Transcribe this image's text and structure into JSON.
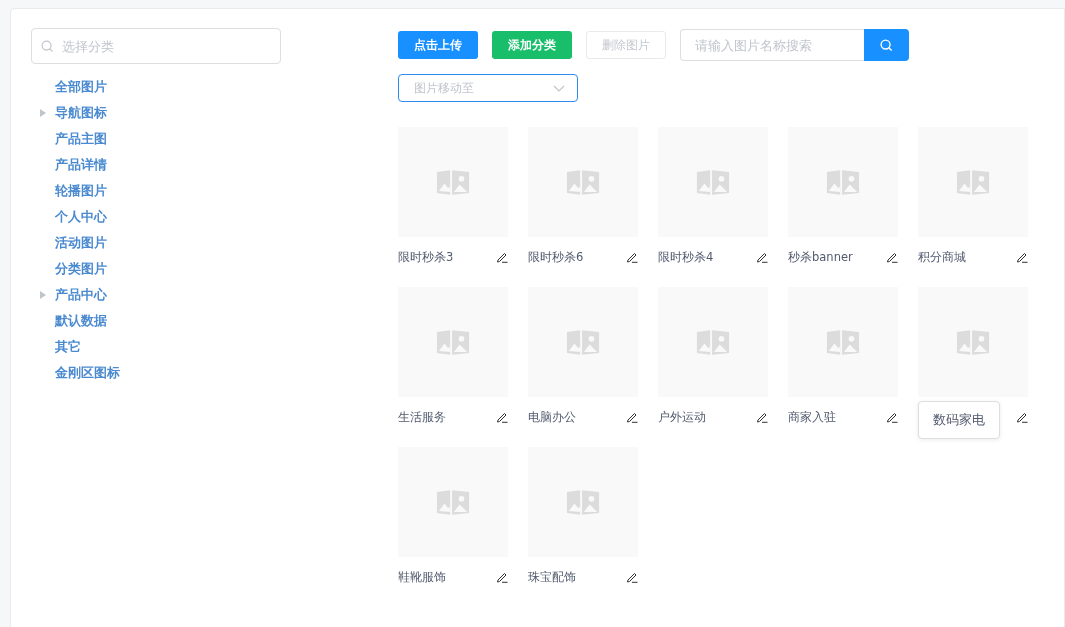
{
  "sidebar": {
    "search": {
      "placeholder": "选择分类"
    },
    "tree": [
      {
        "label": "全部图片",
        "expandable": false
      },
      {
        "label": "导航图标",
        "expandable": true
      },
      {
        "label": "产品主图",
        "expandable": false
      },
      {
        "label": "产品详情",
        "expandable": false
      },
      {
        "label": "轮播图片",
        "expandable": false
      },
      {
        "label": "个人中心",
        "expandable": false
      },
      {
        "label": "活动图片",
        "expandable": false
      },
      {
        "label": "分类图片",
        "expandable": false
      },
      {
        "label": "产品中心",
        "expandable": true
      },
      {
        "label": "默认数据",
        "expandable": false
      },
      {
        "label": "其它",
        "expandable": false
      },
      {
        "label": "金刚区图标",
        "expandable": false
      }
    ]
  },
  "toolbar": {
    "buttons": [
      {
        "label": "点击上传",
        "kind": "primary",
        "disabled": false
      },
      {
        "label": "添加分类",
        "kind": "success",
        "disabled": false
      },
      {
        "label": "删除图片",
        "kind": "default",
        "disabled": true
      }
    ],
    "search": {
      "placeholder": "请输入图片名称搜索"
    },
    "move_select": {
      "placeholder": "图片移动至"
    }
  },
  "images": [
    {
      "name": "限时秒杀3",
      "tooltip": false
    },
    {
      "name": "限时秒杀6",
      "tooltip": false
    },
    {
      "name": "限时秒杀4",
      "tooltip": false
    },
    {
      "name": "秒杀banner",
      "tooltip": false
    },
    {
      "name": "积分商城",
      "tooltip": false
    },
    {
      "name": "生活服务",
      "tooltip": false
    },
    {
      "name": "电脑办公",
      "tooltip": false
    },
    {
      "name": "户外运动",
      "tooltip": false
    },
    {
      "name": "商家入驻",
      "tooltip": false
    },
    {
      "name": "数码家电",
      "tooltip": true
    },
    {
      "name": "鞋靴服饰",
      "tooltip": false
    },
    {
      "name": "珠宝配饰",
      "tooltip": false
    }
  ]
}
